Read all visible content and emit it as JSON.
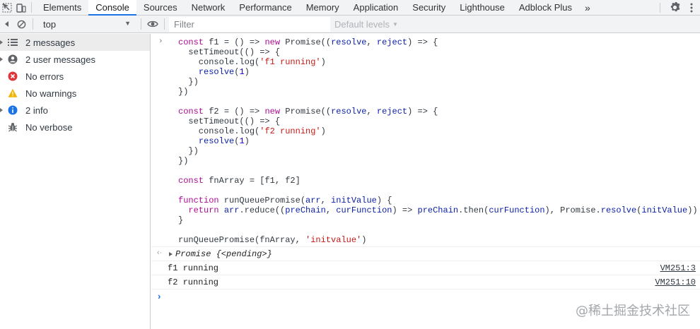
{
  "tabs": [
    {
      "label": "Elements"
    },
    {
      "label": "Console",
      "active": true
    },
    {
      "label": "Sources"
    },
    {
      "label": "Network"
    },
    {
      "label": "Performance"
    },
    {
      "label": "Memory"
    },
    {
      "label": "Application"
    },
    {
      "label": "Security"
    },
    {
      "label": "Lighthouse"
    },
    {
      "label": "Adblock Plus"
    }
  ],
  "more_tabs_glyph": "»",
  "toolbar": {
    "context": "top",
    "filter_placeholder": "Filter",
    "levels": "Default levels"
  },
  "sidebar": {
    "items": [
      {
        "label": "2 messages",
        "icon": "list-icon"
      },
      {
        "label": "2 user messages",
        "icon": "user-icon"
      },
      {
        "label": "No errors",
        "icon": "error-icon"
      },
      {
        "label": "No warnings",
        "icon": "warning-icon"
      },
      {
        "label": "2 info",
        "icon": "info-icon"
      },
      {
        "label": "No verbose",
        "icon": "bug-icon"
      }
    ]
  },
  "console": {
    "input_prompt": "›",
    "code_lines": [
      "const f1 = () => new Promise((resolve, reject) => {",
      "  setTimeout(() => {",
      "    console.log('f1 running')",
      "    resolve(1)",
      "  })",
      "})",
      "",
      "const f2 = () => new Promise((resolve, reject) => {",
      "  setTimeout(() => {",
      "    console.log('f2 running')",
      "    resolve(1)",
      "  })",
      "})",
      "",
      "const fnArray = [f1, f2]",
      "",
      "function runQueuePromise(arr, initValue) {",
      "  return arr.reduce((preChain, curFunction) => preChain.then(curFunction), Promise.resolve(initValue))",
      "}",
      "",
      "runQueuePromise(fnArray, 'initvalue')"
    ],
    "return_glyph": "‹·",
    "result": "Promise {<pending>}",
    "logs": [
      {
        "message": "f1 running",
        "source": "VM251:3"
      },
      {
        "message": "f2 running",
        "source": "VM251:10"
      }
    ]
  },
  "watermark": "@稀土掘金技术社区",
  "colors": {
    "keyword": "#aa0d91",
    "string": "#c41a16",
    "number": "#1c00cf",
    "param": "#0d22aa",
    "accent": "#1a73e8"
  }
}
